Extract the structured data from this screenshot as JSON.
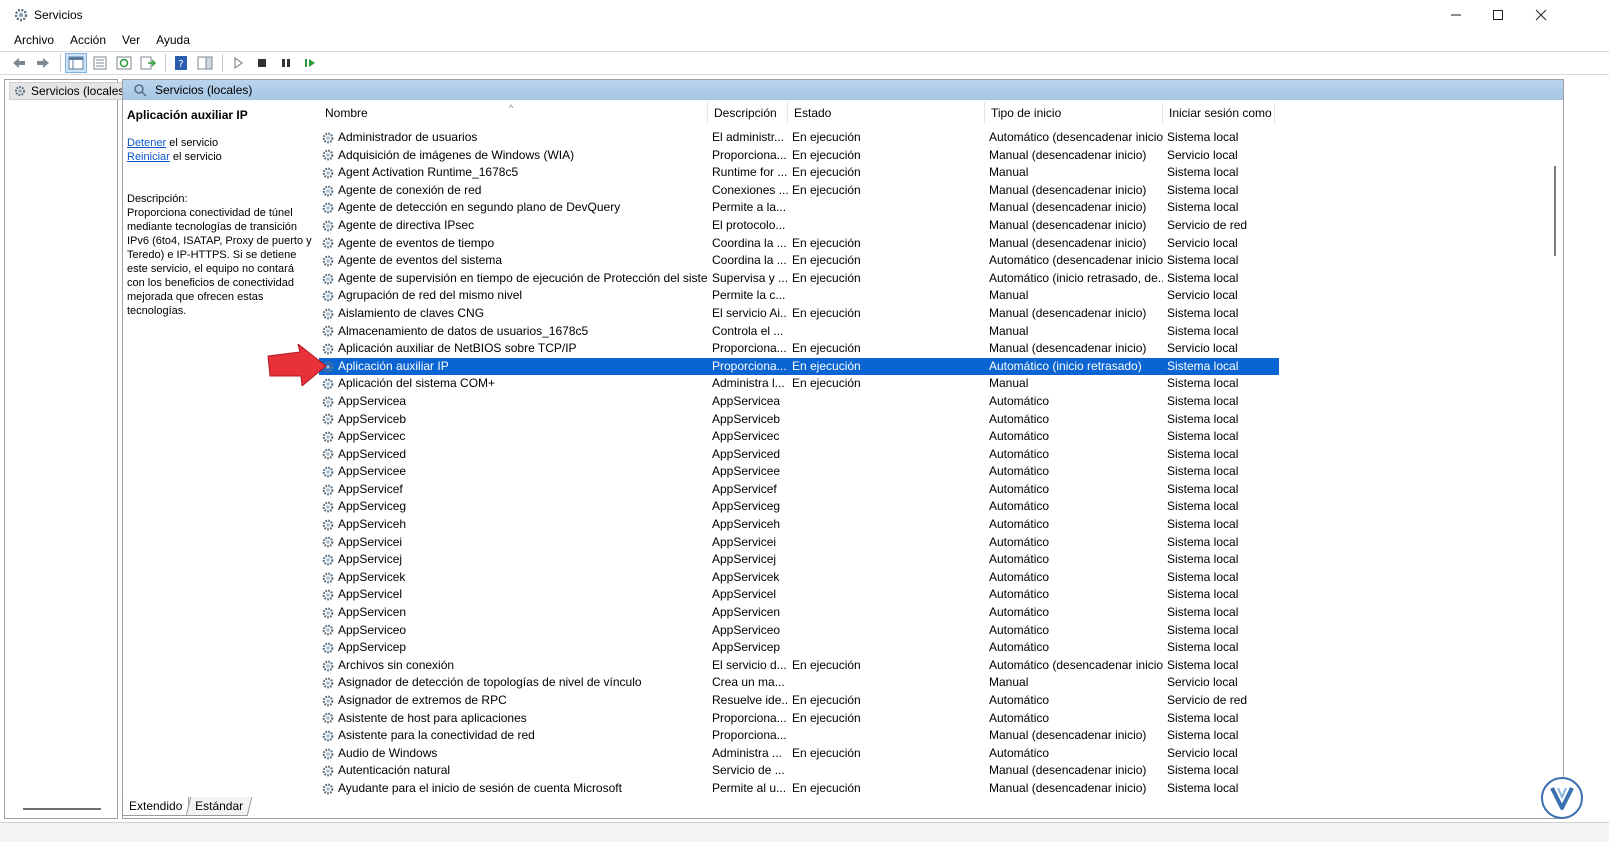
{
  "window": {
    "title": "Servicios"
  },
  "menu": [
    "Archivo",
    "Acción",
    "Ver",
    "Ayuda"
  ],
  "tree": {
    "root_label": "Servicios (locales)"
  },
  "pane_header": {
    "label": "Servicios (locales)"
  },
  "detail": {
    "title": "Aplicación auxiliar IP",
    "stop_link": "Detener",
    "stop_suffix": " el servicio",
    "restart_link": "Reiniciar",
    "restart_suffix": " el servicio",
    "description_label": "Descripción:",
    "description_text": "Proporciona conectividad de túnel mediante tecnologías de transición IPv6 (6to4, ISATAP, Proxy de puerto y Teredo) e IP-HTTPS. Si se detiene este servicio, el equipo no contará con los beneficios de conectividad mejorada que ofrecen estas tecnologías."
  },
  "columns": {
    "name": "Nombre",
    "description": "Descripción",
    "state": "Estado",
    "startup": "Tipo de inicio",
    "logon": "Iniciar sesión como"
  },
  "rows": [
    {
      "name": "Administrador de usuarios",
      "desc": "El administr...",
      "state": "En ejecución",
      "startup": "Automático (desencadenar inicio)",
      "logon": "Sistema local"
    },
    {
      "name": "Adquisición de imágenes de Windows (WIA)",
      "desc": "Proporciona...",
      "state": "En ejecución",
      "startup": "Manual (desencadenar inicio)",
      "logon": "Servicio local"
    },
    {
      "name": "Agent Activation Runtime_1678c5",
      "desc": "Runtime for ...",
      "state": "En ejecución",
      "startup": "Manual",
      "logon": "Sistema local"
    },
    {
      "name": "Agente de conexión de red",
      "desc": "Conexiones ...",
      "state": "En ejecución",
      "startup": "Manual (desencadenar inicio)",
      "logon": "Sistema local"
    },
    {
      "name": "Agente de detección en segundo plano de DevQuery",
      "desc": "Permite a la...",
      "state": "",
      "startup": "Manual (desencadenar inicio)",
      "logon": "Sistema local"
    },
    {
      "name": "Agente de directiva IPsec",
      "desc": "El protocolo...",
      "state": "",
      "startup": "Manual (desencadenar inicio)",
      "logon": "Servicio de red"
    },
    {
      "name": "Agente de eventos de tiempo",
      "desc": "Coordina la ...",
      "state": "En ejecución",
      "startup": "Manual (desencadenar inicio)",
      "logon": "Servicio local"
    },
    {
      "name": "Agente de eventos del sistema",
      "desc": "Coordina la ...",
      "state": "En ejecución",
      "startup": "Automático (desencadenar inicio)",
      "logon": "Sistema local"
    },
    {
      "name": "Agente de supervisión en tiempo de ejecución de Protección del sistema",
      "desc": "Supervisa y ...",
      "state": "En ejecución",
      "startup": "Automático (inicio retrasado, de...",
      "logon": "Sistema local"
    },
    {
      "name": "Agrupación de red del mismo nivel",
      "desc": "Permite la c...",
      "state": "",
      "startup": "Manual",
      "logon": "Servicio local"
    },
    {
      "name": "Aislamiento de claves CNG",
      "desc": "El servicio Ai...",
      "state": "En ejecución",
      "startup": "Manual (desencadenar inicio)",
      "logon": "Sistema local"
    },
    {
      "name": "Almacenamiento de datos de usuarios_1678c5",
      "desc": "Controla el ...",
      "state": "",
      "startup": "Manual",
      "logon": "Sistema local"
    },
    {
      "name": "Aplicación auxiliar de NetBIOS sobre TCP/IP",
      "desc": "Proporciona...",
      "state": "En ejecución",
      "startup": "Manual (desencadenar inicio)",
      "logon": "Servicio local"
    },
    {
      "name": "Aplicación auxiliar IP",
      "desc": "Proporciona...",
      "state": "En ejecución",
      "startup": "Automático (inicio retrasado)",
      "logon": "Sistema local",
      "selected": true
    },
    {
      "name": "Aplicación del sistema COM+",
      "desc": "Administra l...",
      "state": "En ejecución",
      "startup": "Manual",
      "logon": "Sistema local"
    },
    {
      "name": "AppServicea",
      "desc": "AppServicea",
      "state": "",
      "startup": "Automático",
      "logon": "Sistema local"
    },
    {
      "name": "AppServiceb",
      "desc": "AppServiceb",
      "state": "",
      "startup": "Automático",
      "logon": "Sistema local"
    },
    {
      "name": "AppServicec",
      "desc": "AppServicec",
      "state": "",
      "startup": "Automático",
      "logon": "Sistema local"
    },
    {
      "name": "AppServiced",
      "desc": "AppServiced",
      "state": "",
      "startup": "Automático",
      "logon": "Sistema local"
    },
    {
      "name": "AppServicee",
      "desc": "AppServicee",
      "state": "",
      "startup": "Automático",
      "logon": "Sistema local"
    },
    {
      "name": "AppServicef",
      "desc": "AppServicef",
      "state": "",
      "startup": "Automático",
      "logon": "Sistema local"
    },
    {
      "name": "AppServiceg",
      "desc": "AppServiceg",
      "state": "",
      "startup": "Automático",
      "logon": "Sistema local"
    },
    {
      "name": "AppServiceh",
      "desc": "AppServiceh",
      "state": "",
      "startup": "Automático",
      "logon": "Sistema local"
    },
    {
      "name": "AppServicei",
      "desc": "AppServicei",
      "state": "",
      "startup": "Automático",
      "logon": "Sistema local"
    },
    {
      "name": "AppServicej",
      "desc": "AppServicej",
      "state": "",
      "startup": "Automático",
      "logon": "Sistema local"
    },
    {
      "name": "AppServicek",
      "desc": "AppServicek",
      "state": "",
      "startup": "Automático",
      "logon": "Sistema local"
    },
    {
      "name": "AppServicel",
      "desc": "AppServicel",
      "state": "",
      "startup": "Automático",
      "logon": "Sistema local"
    },
    {
      "name": "AppServicen",
      "desc": "AppServicen",
      "state": "",
      "startup": "Automático",
      "logon": "Sistema local"
    },
    {
      "name": "AppServiceo",
      "desc": "AppServiceo",
      "state": "",
      "startup": "Automático",
      "logon": "Sistema local"
    },
    {
      "name": "AppServicep",
      "desc": "AppServicep",
      "state": "",
      "startup": "Automático",
      "logon": "Sistema local"
    },
    {
      "name": "Archivos sin conexión",
      "desc": "El servicio d...",
      "state": "En ejecución",
      "startup": "Automático (desencadenar inicio)",
      "logon": "Sistema local"
    },
    {
      "name": "Asignador de detección de topologías de nivel de vínculo",
      "desc": "Crea un ma...",
      "state": "",
      "startup": "Manual",
      "logon": "Servicio local"
    },
    {
      "name": "Asignador de extremos de RPC",
      "desc": "Resuelve ide...",
      "state": "En ejecución",
      "startup": "Automático",
      "logon": "Servicio de red"
    },
    {
      "name": "Asistente de host para aplicaciones",
      "desc": "Proporciona...",
      "state": "En ejecución",
      "startup": "Automático",
      "logon": "Sistema local"
    },
    {
      "name": "Asistente para la conectividad de red",
      "desc": "Proporciona...",
      "state": "",
      "startup": "Manual (desencadenar inicio)",
      "logon": "Sistema local"
    },
    {
      "name": "Audio de Windows",
      "desc": "Administra ...",
      "state": "En ejecución",
      "startup": "Automático",
      "logon": "Servicio local"
    },
    {
      "name": "Autenticación natural",
      "desc": "Servicio de ...",
      "state": "",
      "startup": "Manual (desencadenar inicio)",
      "logon": "Sistema local"
    },
    {
      "name": "Ayudante para el inicio de sesión de cuenta Microsoft",
      "desc": "Permite al u...",
      "state": "En ejecución",
      "startup": "Manual (desencadenar inicio)",
      "logon": "Sistema local"
    }
  ],
  "tabs": [
    "Extendido",
    "Estándar"
  ],
  "colors": {
    "selection": "#0a64d2",
    "header_band": "#b9d4ec",
    "link": "#0b57c9",
    "arrow": "#e8323a"
  },
  "icons": [
    "gear-icon",
    "back-icon",
    "forward-icon",
    "play-icon",
    "stop-icon",
    "pause-icon",
    "restart-icon",
    "help-icon"
  ]
}
